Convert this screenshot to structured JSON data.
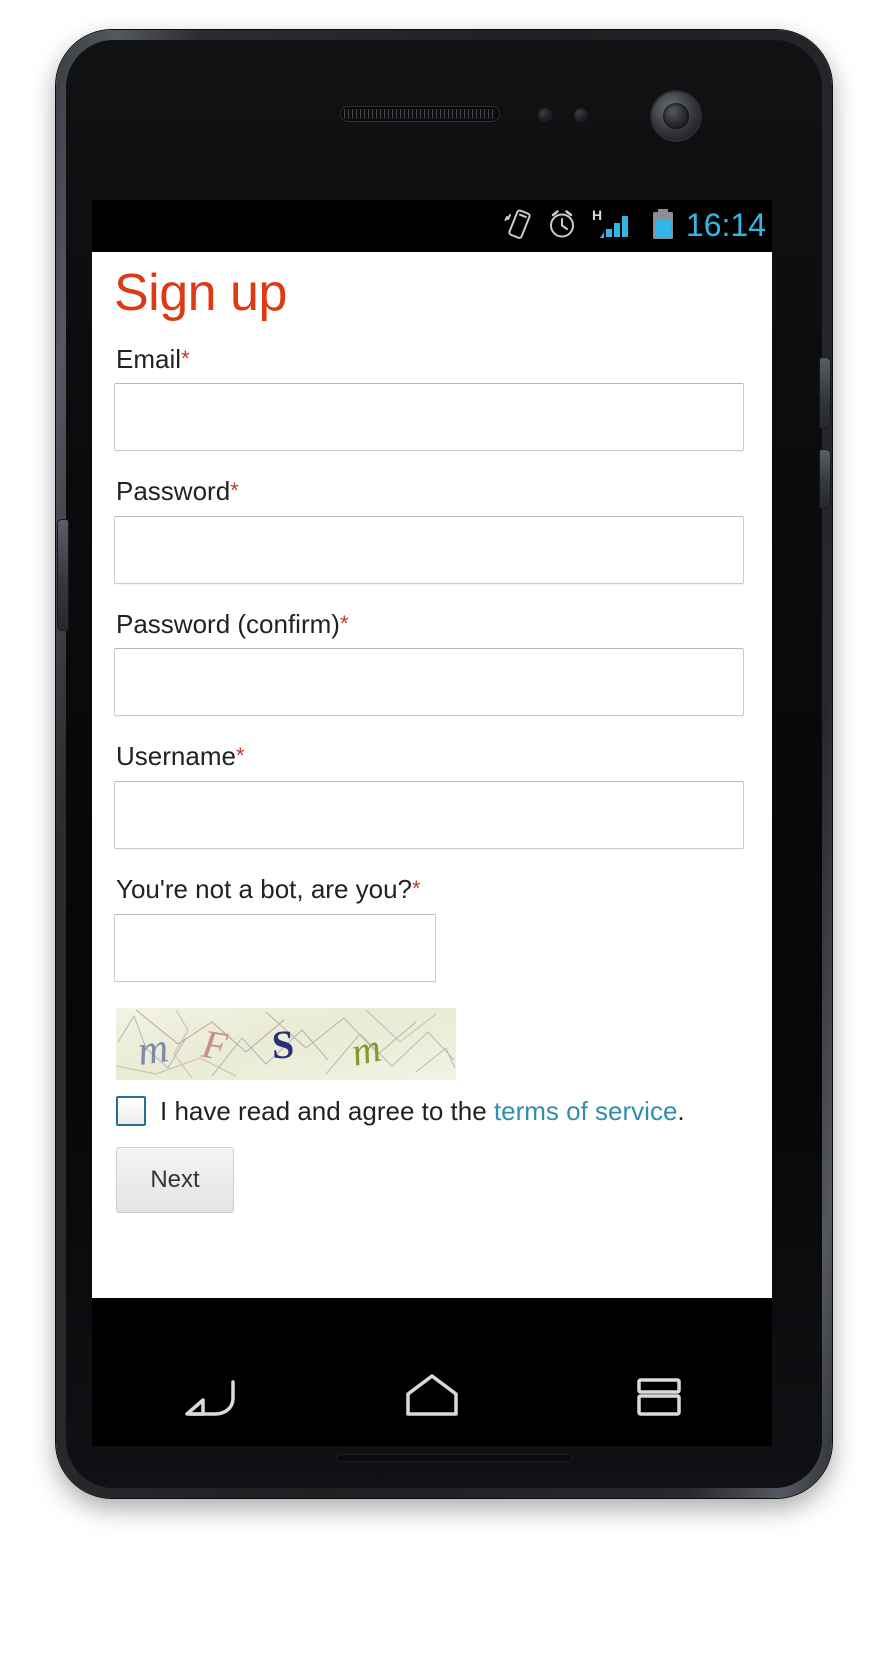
{
  "device": {
    "type": "android-phone",
    "frame_color": "#2a2c30"
  },
  "status_bar": {
    "background": "#000000",
    "accent_color": "#33b5e5",
    "clock": "16:14",
    "icons": [
      {
        "name": "vibrate-icon",
        "label": "Vibrate mode"
      },
      {
        "name": "alarm-clock-icon",
        "label": "Alarm set"
      },
      {
        "name": "signal-bars-icon",
        "label": "H",
        "network_type": "H"
      },
      {
        "name": "battery-icon",
        "label": "Battery"
      }
    ]
  },
  "page": {
    "title": "Sign up",
    "title_color": "#dd3a13",
    "required_marker": "*",
    "required_marker_color": "#c0392b",
    "fields": [
      {
        "name": "email",
        "label": "Email",
        "required": true,
        "value": "",
        "placeholder": "",
        "type": "email",
        "width": "full"
      },
      {
        "name": "password",
        "label": "Password",
        "required": true,
        "value": "",
        "placeholder": "",
        "type": "password",
        "width": "full"
      },
      {
        "name": "password_confirm",
        "label": "Password (confirm)",
        "required": true,
        "value": "",
        "placeholder": "",
        "type": "password",
        "width": "full"
      },
      {
        "name": "username",
        "label": "Username",
        "required": true,
        "value": "",
        "placeholder": "",
        "type": "text",
        "width": "full"
      },
      {
        "name": "captcha_answer",
        "label": "You're not a bot, are you?",
        "required": true,
        "value": "",
        "placeholder": "",
        "type": "text",
        "width": "short"
      }
    ],
    "captcha": {
      "name": "captcha-image",
      "characters": [
        {
          "char": "m",
          "color": "#7e8aa8"
        },
        {
          "char": "F",
          "color": "#c98f8f"
        },
        {
          "char": "S",
          "color": "#2b2f7a"
        },
        {
          "char": "m",
          "color": "#7f9b2f"
        }
      ],
      "background_color": "#eceedc"
    },
    "terms": {
      "checkbox_checked": false,
      "text_before": "I have read and agree to the ",
      "link_text": "terms of service",
      "link_color": "#2f8fab",
      "text_after": "."
    },
    "submit": {
      "label": "Next"
    }
  },
  "nav_bar": {
    "background": "#000000",
    "buttons": [
      {
        "name": "back-button",
        "icon": "back-arrow-icon",
        "label": "Back"
      },
      {
        "name": "home-button",
        "icon": "home-icon",
        "label": "Home"
      },
      {
        "name": "recents-button",
        "icon": "recent-apps-icon",
        "label": "Recent apps"
      }
    ]
  }
}
